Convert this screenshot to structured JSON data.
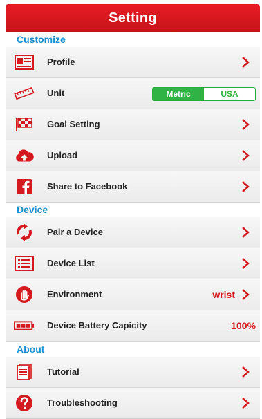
{
  "header": {
    "title": "Setting"
  },
  "sections": {
    "customize": "Customize",
    "device": "Device",
    "about": "About"
  },
  "rows": {
    "profile": "Profile",
    "unit": "Unit",
    "goal": "Goal Setting",
    "upload": "Upload",
    "facebook": "Share to Facebook",
    "pair": "Pair a Device",
    "device_list": "Device List",
    "environment": "Environment",
    "battery": "Device Battery Capicity",
    "tutorial": "Tutorial",
    "troubleshooting": "Troubleshooting"
  },
  "unit_toggle": {
    "metric": "Metric",
    "usa": "USA",
    "selected": "Metric"
  },
  "environment_value": "wrist",
  "battery_value": "100%",
  "colors": {
    "accent": "#d41a1f",
    "section": "#1a8fd0",
    "toggle": "#2fb344"
  }
}
